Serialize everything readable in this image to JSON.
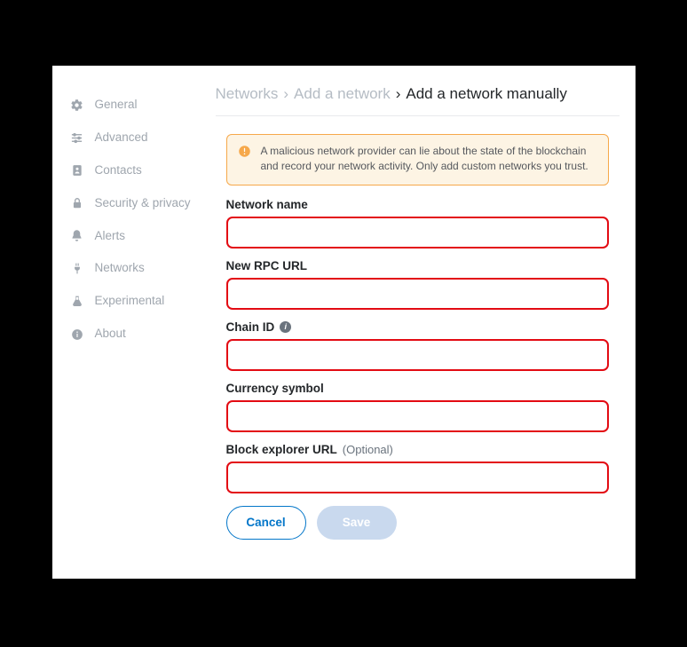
{
  "sidebar": {
    "items": [
      {
        "label": "General"
      },
      {
        "label": "Advanced"
      },
      {
        "label": "Contacts"
      },
      {
        "label": "Security & privacy"
      },
      {
        "label": "Alerts"
      },
      {
        "label": "Networks"
      },
      {
        "label": "Experimental"
      },
      {
        "label": "About"
      }
    ]
  },
  "breadcrumb": {
    "level1": "Networks",
    "level2": "Add a network",
    "current": "Add a network manually"
  },
  "warning": {
    "text": "A malicious network provider can lie about the state of the blockchain and record your network activity. Only add custom networks you trust."
  },
  "form": {
    "network_name": {
      "label": "Network name",
      "value": ""
    },
    "rpc_url": {
      "label": "New RPC URL",
      "value": ""
    },
    "chain_id": {
      "label": "Chain ID",
      "value": ""
    },
    "currency": {
      "label": "Currency symbol",
      "value": ""
    },
    "explorer": {
      "label": "Block explorer URL",
      "optional": "(Optional)",
      "value": ""
    }
  },
  "buttons": {
    "cancel": "Cancel",
    "save": "Save"
  }
}
